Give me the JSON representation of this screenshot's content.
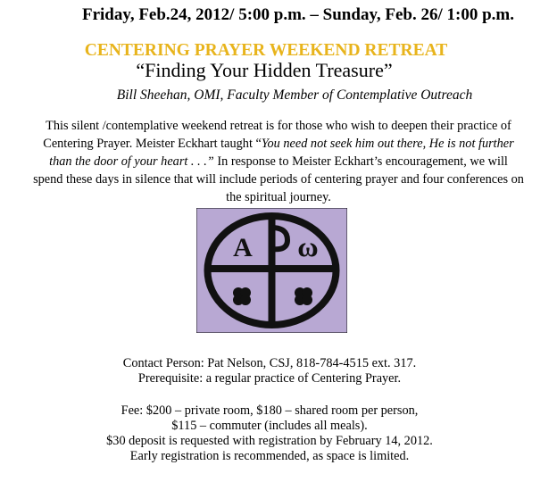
{
  "header": {
    "date_line": "Friday, Feb.24, 2012/ 5:00 p.m. – Sunday, Feb. 26/ 1:00 p.m.",
    "title": "CENTERING PRAYER WEEKEND RETREAT",
    "subtitle": "“Finding Your Hidden Treasure”",
    "presenter": "Bill Sheehan, OMI, Faculty Member of Contemplative Outreach"
  },
  "description": {
    "line1": "This silent /contemplative weekend retreat is for those who wish to deepen their practice of",
    "line2_start": "Centering Prayer. Meister Eckhart taught “",
    "line2_quote": "You need not seek him out there, He is not further",
    "line3_quote": "than the door of your heart . . .”",
    "line3_rest": " In response to Meister Eckhart’s encouragement, we will",
    "line4": "spend these days in silence that will include periods of centering prayer and four conferences on",
    "line5": "the spiritual journey."
  },
  "emblem": {
    "letter_left": "A",
    "letter_right": "ω",
    "background_color": "#b8a8d3",
    "ink_color": "#111111"
  },
  "details": {
    "contact": "Contact Person: Pat Nelson, CSJ, 818-784-4515 ext. 317.",
    "prerequisite": "Prerequisite: a regular practice of Centering Prayer.",
    "fee_line1": "Fee: $200 – private room, $180 – shared room per person,",
    "fee_line2": "$115 – commuter (includes all meals).",
    "deposit": "$30 deposit is requested with registration by February 14, 2012.",
    "early": "Early registration is recommended, as space is limited."
  },
  "colors": {
    "title": "#e8b41c",
    "text": "#000000"
  }
}
